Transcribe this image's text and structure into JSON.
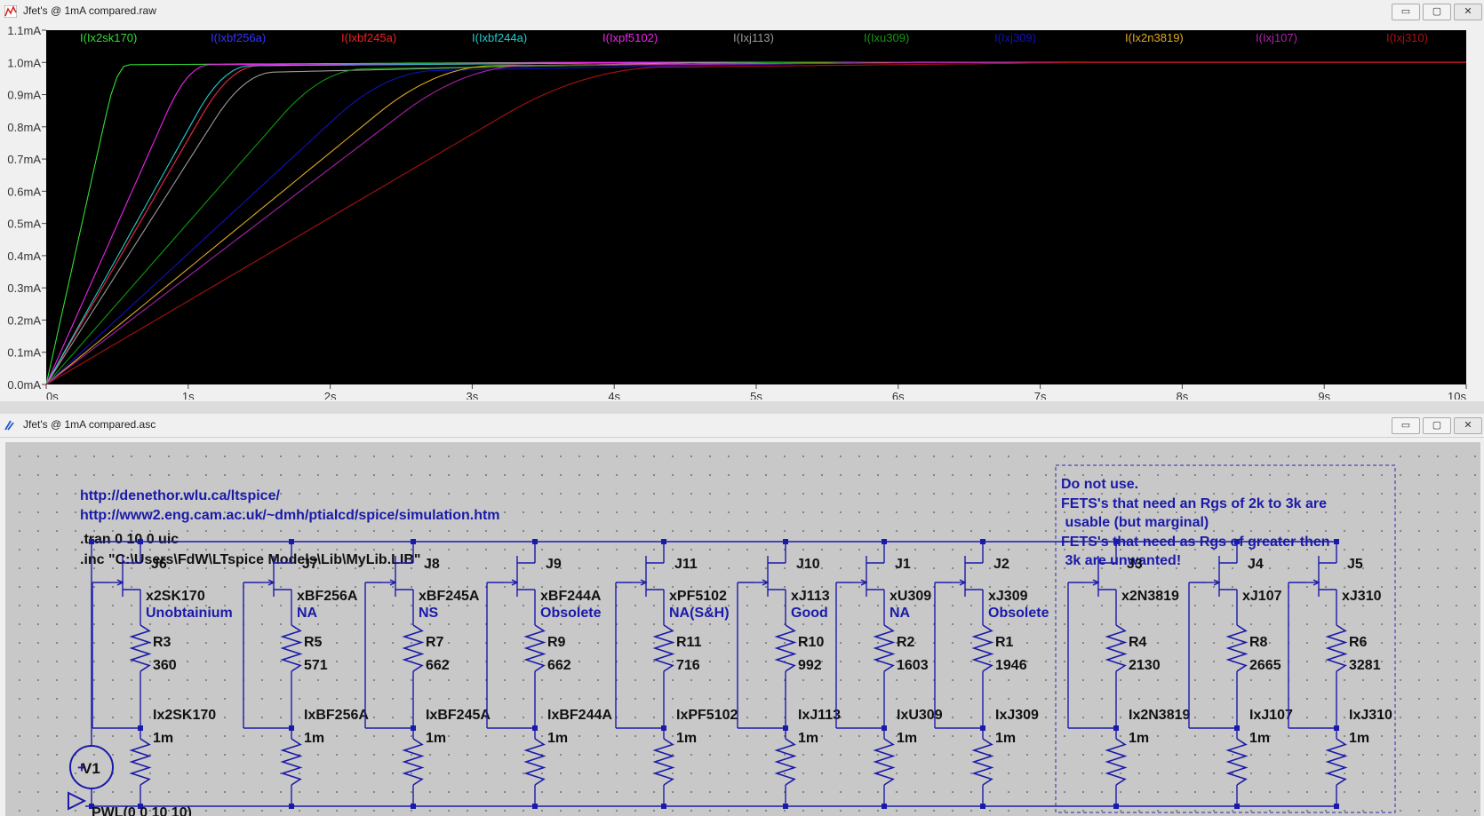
{
  "plot_window": {
    "title": "Jfet's @ 1mA compared.raw",
    "min_label": "▭",
    "max_label": "▢",
    "close_label": "✕"
  },
  "schematic_window": {
    "title": "Jfet's @ 1mA compared.asc",
    "min_label": "▭",
    "max_label": "▢",
    "close_label": "✕"
  },
  "chart_data": {
    "type": "line",
    "x_ticks": [
      "0s",
      "1s",
      "2s",
      "3s",
      "4s",
      "5s",
      "6s",
      "7s",
      "8s",
      "9s",
      "10s"
    ],
    "y_ticks": [
      "0.0mA",
      "0.1mA",
      "0.2mA",
      "0.3mA",
      "0.4mA",
      "0.5mA",
      "0.6mA",
      "0.7mA",
      "0.8mA",
      "0.9mA",
      "1.0mA",
      "1.1mA"
    ],
    "xlim": [
      0,
      10
    ],
    "ylim": [
      0,
      1.1
    ],
    "grid": false,
    "legend_placement": "top",
    "series": [
      {
        "name": "I(Ix2sk170)",
        "color": "#33dd33",
        "rise": 0.5,
        "final": 0.993
      },
      {
        "name": "I(Ixbf256a)",
        "color": "#3333ff",
        "rise": 1.3,
        "final": 0.99
      },
      {
        "name": "I(Ixbf245a)",
        "color": "#ee2222",
        "rise": 1.3,
        "final": 0.99
      },
      {
        "name": "I(Ixbf244a)",
        "color": "#22cccc",
        "rise": 1.25,
        "final": 0.99
      },
      {
        "name": "I(Ixpf5102)",
        "color": "#ee22ee",
        "rise": 1.0,
        "final": 0.993
      },
      {
        "name": "I(Ixj113)",
        "color": "#999999",
        "rise": 1.4,
        "final": 0.97
      },
      {
        "name": "I(Ixu309)",
        "color": "#119911",
        "rise": 1.95,
        "final": 0.98
      },
      {
        "name": "I(Ixj309)",
        "color": "#1111bb",
        "rise": 2.4,
        "final": 0.975
      },
      {
        "name": "I(Ix2n3819)",
        "color": "#ddaa22",
        "rise": 2.75,
        "final": 0.99
      },
      {
        "name": "I(Ixj107)",
        "color": "#aa22aa",
        "rise": 2.95,
        "final": 0.99
      },
      {
        "name": "I(Ixj310)",
        "color": "#aa1111",
        "rise": 3.8,
        "final": 0.985
      }
    ]
  },
  "schematic": {
    "links": [
      "http://denethor.wlu.ca/ltspice/",
      "http://www2.eng.cam.ac.uk/~dmh/ptialcd/spice/simulation.htm"
    ],
    "directives": [
      ".tran 0 10 0 uic",
      ".inc \"C:\\Users\\FdW\\LTspice Models\\Lib\\MyLib.LIB\""
    ],
    "note": [
      "Do not use.",
      "FETS's that need an Rgs of 2k to 3k are",
      " usable (but marginal)",
      "FETS's that need as Rgs of greater then",
      " 3k are unwanted!"
    ],
    "source": {
      "name": "V1",
      "value": "PWL(0 0 10 10)"
    },
    "stages": [
      {
        "jfet": "J6",
        "model": "x2SK170",
        "status": "Unobtainium",
        "r": "R3",
        "rv": "360",
        "i": "Ix2SK170",
        "iv": "1m"
      },
      {
        "jfet": "J7",
        "model": "xBF256A",
        "status": "NA",
        "r": "R5",
        "rv": "571",
        "i": "IxBF256A",
        "iv": "1m"
      },
      {
        "jfet": "J8",
        "model": "xBF245A",
        "status": "NS",
        "r": "R7",
        "rv": "662",
        "i": "IxBF245A",
        "iv": "1m"
      },
      {
        "jfet": "J9",
        "model": "xBF244A",
        "status": "Obsolete",
        "r": "R9",
        "rv": "662",
        "i": "IxBF244A",
        "iv": "1m"
      },
      {
        "jfet": "J11",
        "model": "xPF5102",
        "status": "NA(S&H)",
        "r": "R11",
        "rv": "716",
        "i": "IxPF5102",
        "iv": "1m"
      },
      {
        "jfet": "J10",
        "model": "xJ113",
        "status": "Good",
        "r": "R10",
        "rv": "992",
        "i": "IxJ113",
        "iv": "1m"
      },
      {
        "jfet": "J1",
        "model": "xU309",
        "status": "NA",
        "r": "R2",
        "rv": "1603",
        "i": "IxU309",
        "iv": "1m"
      },
      {
        "jfet": "J2",
        "model": "xJ309",
        "status": "Obsolete",
        "r": "R1",
        "rv": "1946",
        "i": "IxJ309",
        "iv": "1m"
      },
      {
        "jfet": "J3",
        "model": "x2N3819",
        "status": "",
        "r": "R4",
        "rv": "2130",
        "i": "Ix2N3819",
        "iv": "1m"
      },
      {
        "jfet": "J4",
        "model": "xJ107",
        "status": "",
        "r": "R8",
        "rv": "2665",
        "i": "IxJ107",
        "iv": "1m"
      },
      {
        "jfet": "J5",
        "model": "xJ310",
        "status": "",
        "r": "R6",
        "rv": "3281",
        "i": "IxJ310",
        "iv": "1m"
      }
    ]
  }
}
